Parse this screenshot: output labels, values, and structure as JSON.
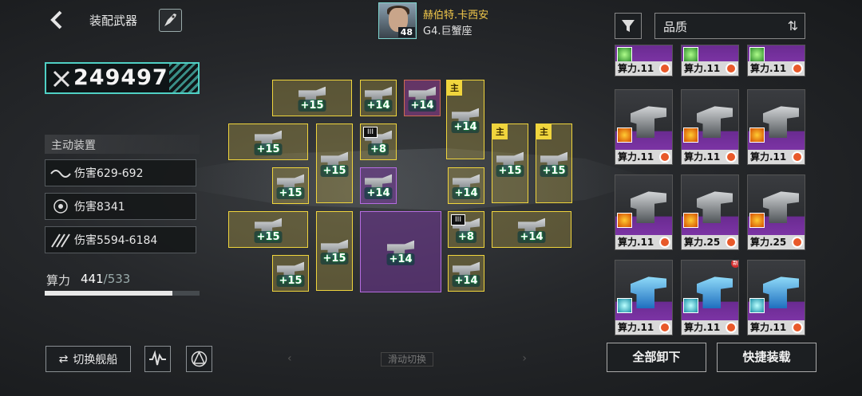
{
  "header": {
    "title": "装配武器"
  },
  "captain": {
    "name": "赫伯特.卡西安",
    "rank": "G4.巨蟹座",
    "level": "48"
  },
  "power": {
    "value": "249497"
  },
  "active_devices": {
    "header": "主动装置",
    "stats": [
      {
        "icon": "wave-icon",
        "label": "伤害629-692"
      },
      {
        "icon": "target-icon",
        "label": "伤害8341"
      },
      {
        "icon": "multi-shot-icon",
        "label": "伤害5594-6184"
      }
    ]
  },
  "capacity": {
    "label": "算力",
    "used": "441",
    "max": "/533",
    "fraction": 0.827
  },
  "buttons": {
    "switch_ship": "切换舰船",
    "unload_all": "全部卸下",
    "quick_equip": "快捷装载"
  },
  "swipe_hint": "滑动切换",
  "filter": {
    "quality_label": "品质"
  },
  "slots": [
    {
      "level": "+15",
      "type": "yellow",
      "tag": ""
    },
    {
      "level": "+14",
      "type": "yellow",
      "tag": ""
    },
    {
      "level": "+14",
      "type": "red",
      "tag": ""
    },
    {
      "level": "+14",
      "type": "yellow",
      "tag": "主"
    },
    {
      "level": "+15",
      "type": "yellow",
      "tag": ""
    },
    {
      "level": "+15",
      "type": "yellow",
      "tag": ""
    },
    {
      "level": "+8",
      "type": "yellow",
      "tag": "III"
    },
    {
      "level": "+15",
      "type": "yellow",
      "tag": "主"
    },
    {
      "level": "+15",
      "type": "yellow",
      "tag": "主"
    },
    {
      "level": "+15",
      "type": "yellow",
      "tag": ""
    },
    {
      "level": "+14",
      "type": "purple",
      "tag": ""
    },
    {
      "level": "+14",
      "type": "yellow",
      "tag": ""
    },
    {
      "level": "+15",
      "type": "yellow",
      "tag": ""
    },
    {
      "level": "+15",
      "type": "yellow",
      "tag": ""
    },
    {
      "level": "+14",
      "type": "purple",
      "tag": ""
    },
    {
      "level": "+8",
      "type": "yellow",
      "tag": "III"
    },
    {
      "level": "+14",
      "type": "yellow",
      "tag": ""
    },
    {
      "level": "+15",
      "type": "yellow",
      "tag": ""
    },
    {
      "level": "+14",
      "type": "yellow",
      "tag": ""
    }
  ],
  "inventory": [
    {
      "cost": "算力.11",
      "element": "green",
      "variant": "grey",
      "new": ""
    },
    {
      "cost": "算力.11",
      "element": "green",
      "variant": "grey",
      "new": ""
    },
    {
      "cost": "算力.11",
      "element": "green",
      "variant": "grey",
      "new": ""
    },
    {
      "cost": "算力.11",
      "element": "fire",
      "variant": "grey",
      "new": ""
    },
    {
      "cost": "算力.11",
      "element": "fire",
      "variant": "grey",
      "new": ""
    },
    {
      "cost": "算力.11",
      "element": "fire",
      "variant": "grey",
      "new": ""
    },
    {
      "cost": "算力.11",
      "element": "fire",
      "variant": "grey",
      "new": ""
    },
    {
      "cost": "算力.25",
      "element": "fire",
      "variant": "grey",
      "new": ""
    },
    {
      "cost": "算力.25",
      "element": "fire",
      "variant": "grey",
      "new": ""
    },
    {
      "cost": "算力.11",
      "element": "teal",
      "variant": "blue",
      "new": ""
    },
    {
      "cost": "算力.11",
      "element": "teal",
      "variant": "blue",
      "new": "新"
    },
    {
      "cost": "算力.11",
      "element": "teal",
      "variant": "blue",
      "new": ""
    }
  ]
}
